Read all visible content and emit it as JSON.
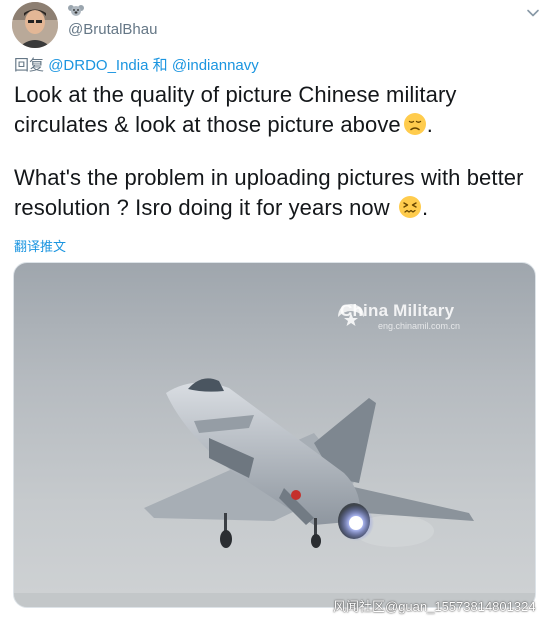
{
  "user": {
    "handle": "@BrutalBhau",
    "badge_icon": "koala-icon"
  },
  "reply": {
    "prefix": "回复",
    "mention1": "@DRDO_India",
    "conjunction": "和",
    "mention2": "@indiannavy"
  },
  "tweet": {
    "paragraph1": "Look at the quality of picture Chinese military circulates & look at those picture above",
    "paragraph1_end": ".",
    "paragraph2": "What's the problem in uploading pictures with better resolution ? Isro doing it for years now",
    "paragraph2_end": "."
  },
  "translate_label": "翻译推文",
  "media": {
    "watermark_brand": "China Military",
    "watermark_url": "eng.chinamil.com.cn"
  },
  "footer_watermark": "风闻社区@guan_15573814801324",
  "colors": {
    "link": "#1b95e0",
    "text": "#14171a",
    "muted": "#657786"
  }
}
